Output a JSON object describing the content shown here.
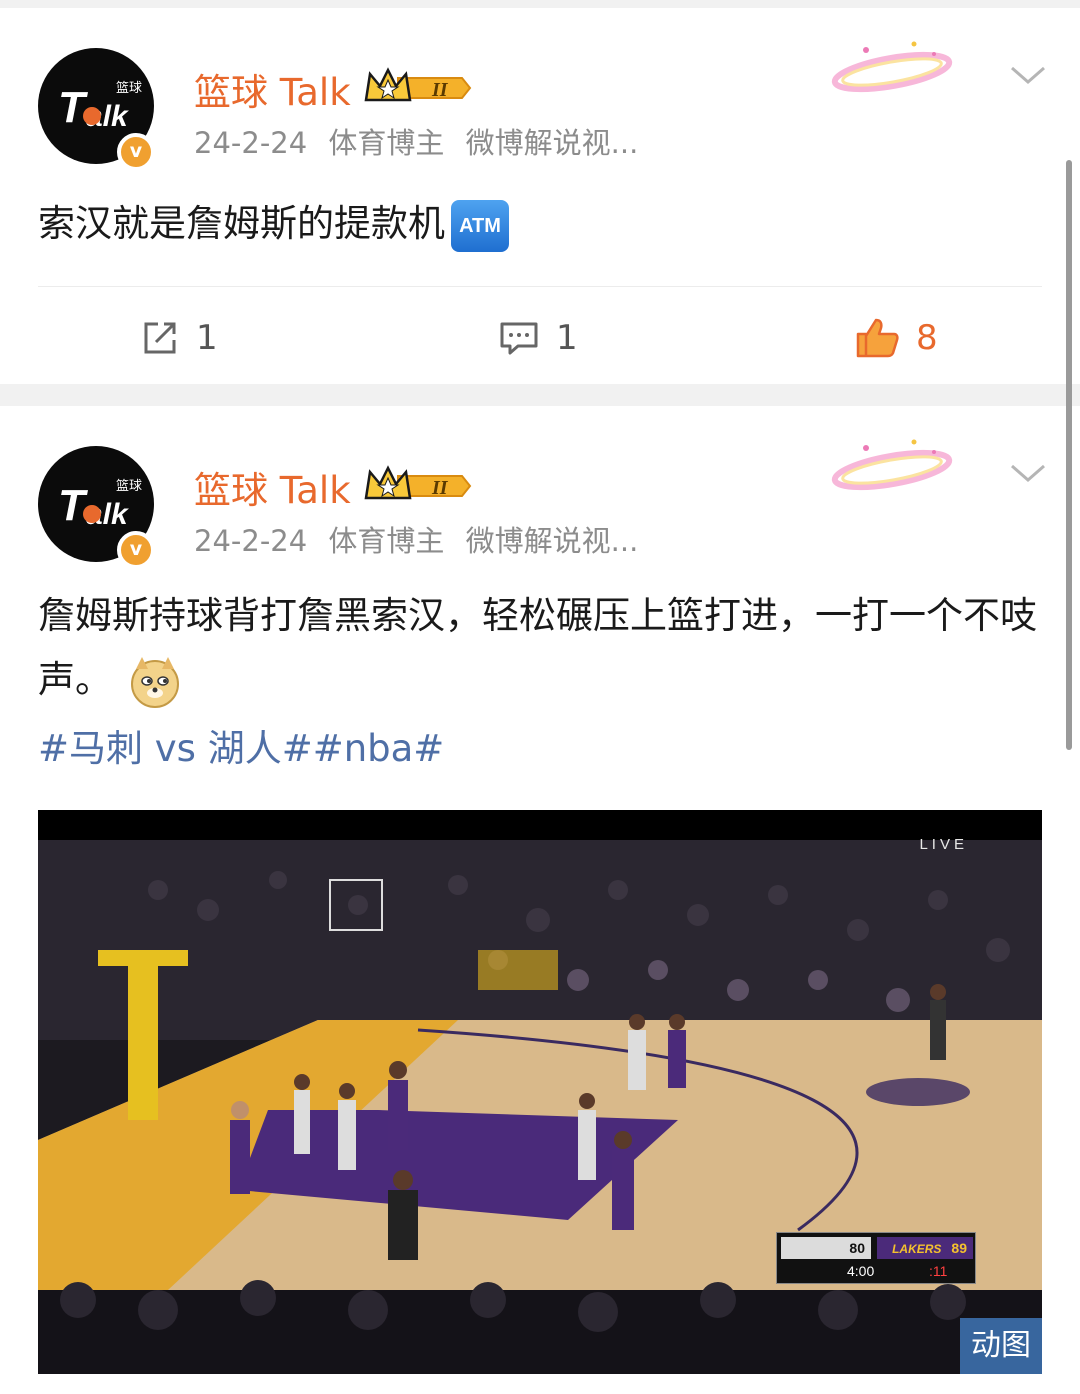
{
  "posts": [
    {
      "username": "篮球 Talk",
      "rank_label": "II",
      "avatar_text": {
        "main": "Talk",
        "sub": "篮球"
      },
      "verified_mark": "v",
      "date": "24-2-24",
      "tags": [
        "体育博主",
        "微博解说视..."
      ],
      "text": "索汉就是詹姆斯的提款机",
      "inline_emoji": "ATM",
      "actions": {
        "reposts": "1",
        "comments": "1",
        "likes": "8"
      }
    },
    {
      "username": "篮球 Talk",
      "rank_label": "II",
      "avatar_text": {
        "main": "Talk",
        "sub": "篮球"
      },
      "verified_mark": "v",
      "date": "24-2-24",
      "tags": [
        "体育博主",
        "微博解说视..."
      ],
      "text": "詹姆斯持球背打詹黑索汉，轻松碾压上篮打进，一打一个不吱声。",
      "inline_emoji": "doge",
      "hashtags": "#马刺 vs 湖人##nba#",
      "media": {
        "live_label": "LIVE",
        "scoreboard": {
          "home_score": "80",
          "away_team": "LAKERS",
          "away_score": "89",
          "clock": "4:00",
          "shot_clock": ":11"
        },
        "gif_label": "动图"
      }
    }
  ],
  "colors": {
    "username": "#e8692d",
    "hashtag": "#4f6fa6",
    "like": "#e8692d",
    "gif_badge": "#3c6eaa"
  },
  "icons": [
    "chevron-down-icon",
    "repost-icon",
    "comment-icon",
    "thumbs-up-icon",
    "rank-crown-icon",
    "halo-icon"
  ]
}
